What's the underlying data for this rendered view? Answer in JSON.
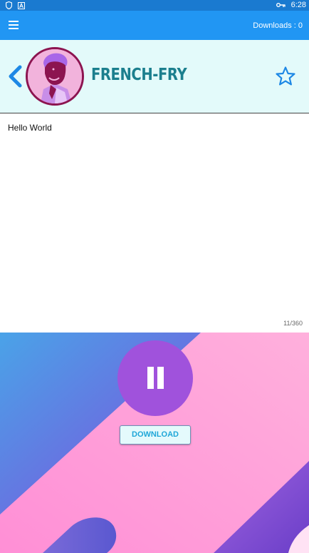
{
  "status_bar": {
    "time": "6:28",
    "left_icons": [
      "shield-icon",
      "a-badge-icon"
    ],
    "right_icons": [
      "key-icon",
      "battery-icon"
    ]
  },
  "app_bar": {
    "downloads_label": "Downloads : 0",
    "menu_icon": "hamburger-menu-icon"
  },
  "profile": {
    "name": "FRENCH-FRY",
    "back_icon": "chevron-left-icon",
    "favorite_icon": "star-outline-icon"
  },
  "content": {
    "text": "Hello World",
    "counter": "11/360"
  },
  "player": {
    "pause_icon": "pause-icon",
    "download_label": "DOWNLOAD"
  },
  "colors": {
    "app_bar": "#2196f3",
    "status_bar": "#1a7ad0",
    "header_bg": "#e3fafa",
    "name_color": "#1b7f8e",
    "pause_button": "#a052dc",
    "download_text": "#1fa7d8"
  }
}
